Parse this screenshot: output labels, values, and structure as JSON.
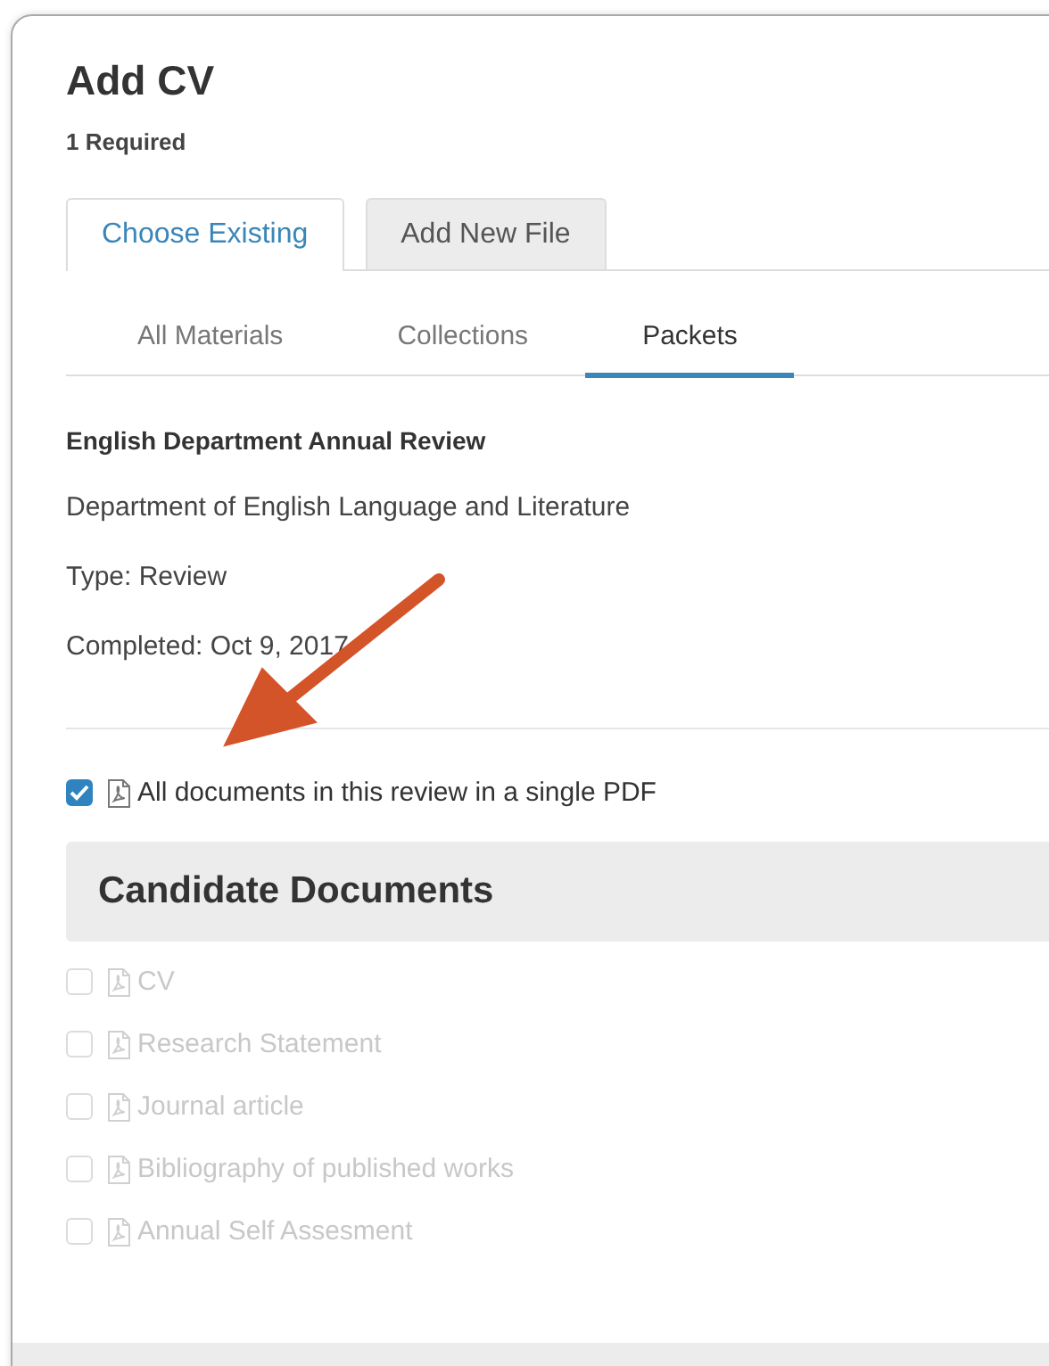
{
  "dialog": {
    "title": "Add CV",
    "subtitle": "1 Required"
  },
  "tabs": [
    {
      "label": "Choose Existing",
      "selected": true
    },
    {
      "label": "Add New File",
      "selected": false
    }
  ],
  "subtabs": [
    {
      "label": "All Materials",
      "selected": false
    },
    {
      "label": "Collections",
      "selected": false
    },
    {
      "label": "Packets",
      "selected": true
    }
  ],
  "packet": {
    "name": "English Department Annual Review",
    "lines": [
      "Department of English Language and Literature",
      "Type: Review",
      "Completed: Oct 9, 2017"
    ]
  },
  "all_in_one": {
    "label": "All documents in this review in a single PDF",
    "checked": true,
    "disabled": false
  },
  "section": {
    "heading": "Candidate Documents",
    "items": [
      {
        "label": "CV",
        "checked": false,
        "disabled": true
      },
      {
        "label": "Research Statement",
        "checked": false,
        "disabled": true
      },
      {
        "label": "Journal article",
        "checked": false,
        "disabled": true
      },
      {
        "label": "Bibliography of published works",
        "checked": false,
        "disabled": true
      },
      {
        "label": "Annual Self Assesment",
        "checked": false,
        "disabled": true
      }
    ]
  }
}
